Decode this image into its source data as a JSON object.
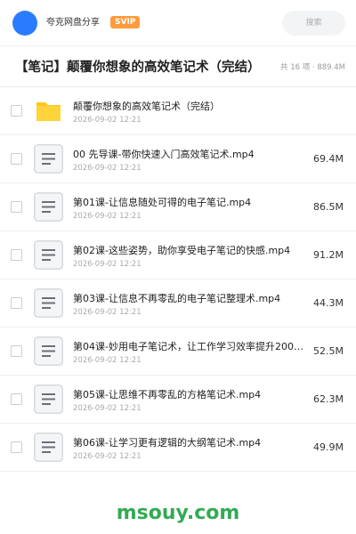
{
  "header": {
    "user_name": "夸克网盘分享",
    "badge": "SVIP",
    "search_placeholder": "搜索",
    "accent_color": "#2b7bff",
    "badge_color": "#ff9a3d"
  },
  "folder": {
    "title": "【笔记】颠覆你想象的高效笔记术（完结）",
    "count_info": "共 16 项 · 889.4M"
  },
  "items": [
    {
      "name": "颠覆你想象的高效笔记术（完结）",
      "date": "2026-09-02 12:21",
      "size": "",
      "icon": "folder-icon"
    },
    {
      "name": "00 先导课-带你快速入门高效笔记术.mp4",
      "date": "2026-09-02 12:21",
      "size": "69.4M",
      "icon": "file-icon"
    },
    {
      "name": "第01课-让信息随处可得的电子笔记.mp4",
      "date": "2026-09-02 12:21",
      "size": "86.5M",
      "icon": "file-icon"
    },
    {
      "name": "第02课-这些姿势，助你享受电子笔记的快感.mp4",
      "date": "2026-09-02 12:21",
      "size": "91.2M",
      "icon": "file-icon"
    },
    {
      "name": "第03课-让信息不再零乱的电子笔记整理术.mp4",
      "date": "2026-09-02 12:21",
      "size": "44.3M",
      "icon": "file-icon"
    },
    {
      "name": "第04课-妙用电子笔记术，让工作学习效率提升200…",
      "date": "2026-09-02 12:21",
      "size": "52.5M",
      "icon": "file-icon"
    },
    {
      "name": "第05课-让思维不再零乱的方格笔记术.mp4",
      "date": "2026-09-02 12:21",
      "size": "62.3M",
      "icon": "file-icon"
    },
    {
      "name": "第06课-让学习更有逻辑的大纲笔记术.mp4",
      "date": "2026-09-02 12:21",
      "size": "49.9M",
      "icon": "file-icon"
    }
  ],
  "watermark": "msouy.com"
}
